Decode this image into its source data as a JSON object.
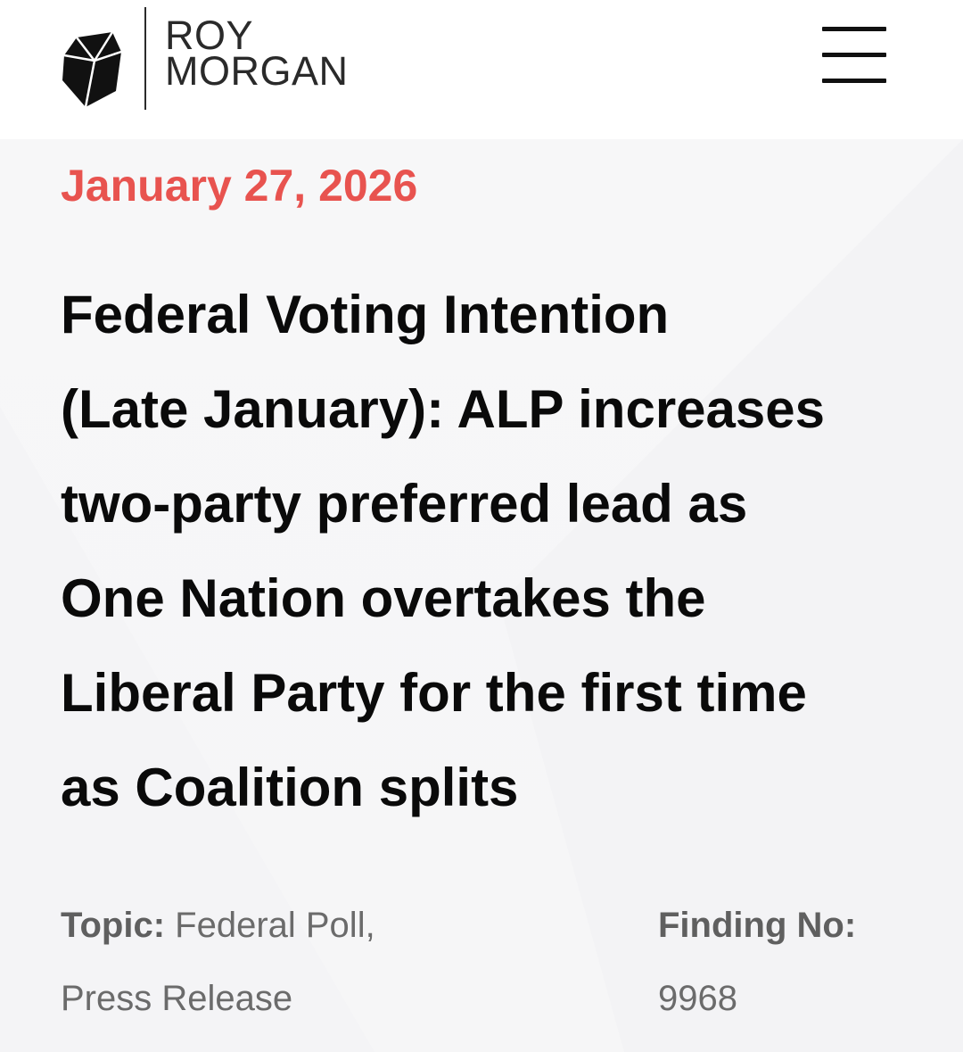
{
  "header": {
    "brand_line1": "ROY",
    "brand_line2": "MORGAN",
    "menu_icon": "hamburger-menu-icon"
  },
  "article": {
    "date": "January 27, 2026",
    "headline_lines": [
      "Federal Voting Intention",
      "(Late January): ALP increases",
      "two-party preferred lead as",
      "One Nation overtakes the",
      "Liberal Party for the first time",
      "as Coalition splits"
    ],
    "topic_label": "Topic:",
    "topic_value_line1": "Federal Poll,",
    "topic_value_line2": "Press Release",
    "finding_label": "Finding No:",
    "finding_value": "9968"
  },
  "colors": {
    "accent_date": "#e8534f",
    "headline": "#0a0a0a",
    "meta_text": "#6b6b6b",
    "background": "#f7f7f8"
  }
}
